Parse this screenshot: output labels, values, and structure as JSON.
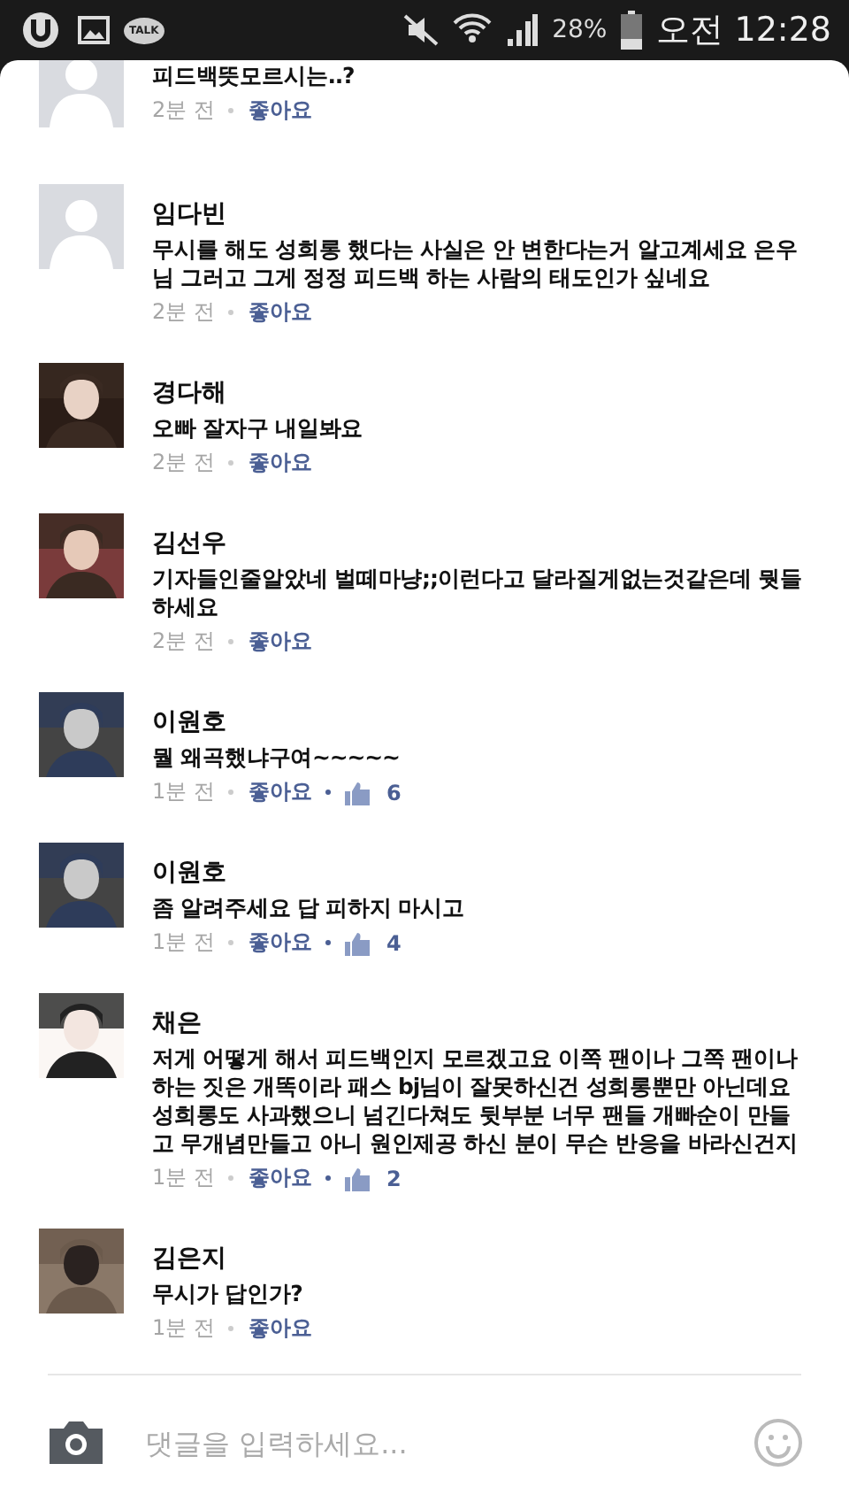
{
  "status_bar": {
    "talk_label": "TALK",
    "battery": "28%",
    "time": "오전 12:28"
  },
  "comments": [
    {
      "kind": "default",
      "text": "피드백뜻모르시는..?",
      "time": "2분 전",
      "like_label": "좋아요"
    },
    {
      "kind": "default",
      "name": "임다빈",
      "text": "무시를 해도 성희롱 했다는 사실은 안 변한다는거 알고계세요 은우님 그러고 그게 정정 피드백 하는 사람의 태도인가 싶네요",
      "time": "2분 전",
      "like_label": "좋아요"
    },
    {
      "name": "경다해",
      "text": "오빠 잘자구 내일봐요",
      "time": "2분 전",
      "like_label": "좋아요"
    },
    {
      "name": "김선우",
      "text": "기자들인줄알았네 벌떼마냥;;이런다고 달라질게없는것같은데 뭣들하세요",
      "time": "2분 전",
      "like_label": "좋아요"
    },
    {
      "name": "이원호",
      "text": "뭘 왜곡했냐구여~~~~~",
      "time": "1분 전",
      "like_label": "좋아요",
      "likes": "6"
    },
    {
      "name": "이원호",
      "text": "좀 알려주세요 답 피하지 마시고",
      "time": "1분 전",
      "like_label": "좋아요",
      "likes": "4"
    },
    {
      "name": "채은",
      "text": "저게 어떻게 해서 피드백인지 모르겠고요 이쪽 팬이나 그쪽 팬이나 하는 짓은 개똑이라 패스 bj님이 잘못하신건 성희롱뿐만 아닌데요 성희롱도 사과했으니 넘긴다쳐도 뒷부분 너무 팬들 개빠순이 만들고 무개념만들고 아니 원인제공 하신 분이 무슨 반응을 바라신건지",
      "time": "1분 전",
      "like_label": "좋아요",
      "likes": "2"
    },
    {
      "name": "김은지",
      "text": "무시가 답인가?",
      "time": "1분 전",
      "like_label": "좋아요"
    }
  ],
  "composer": {
    "placeholder": "댓글을 입력하세요..."
  }
}
